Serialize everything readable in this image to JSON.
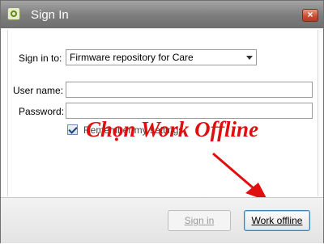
{
  "window": {
    "title": "Sign In",
    "close_symbol": "×",
    "icon": "app-icon",
    "close_icon": "close-icon"
  },
  "form": {
    "sign_in_to_label": "Sign in to:",
    "sign_in_to_value": "Firmware repository for Care",
    "username_label": "User name:",
    "username_value": "",
    "password_label": "Password:",
    "password_value": "",
    "remember_label": "Remember my settings",
    "remember_checked": true
  },
  "annotation": {
    "text": "Chọn Work Offline",
    "color": "#e00e0e"
  },
  "buttons": {
    "sign_in": "Sign in",
    "work_offline": "Work offline"
  }
}
